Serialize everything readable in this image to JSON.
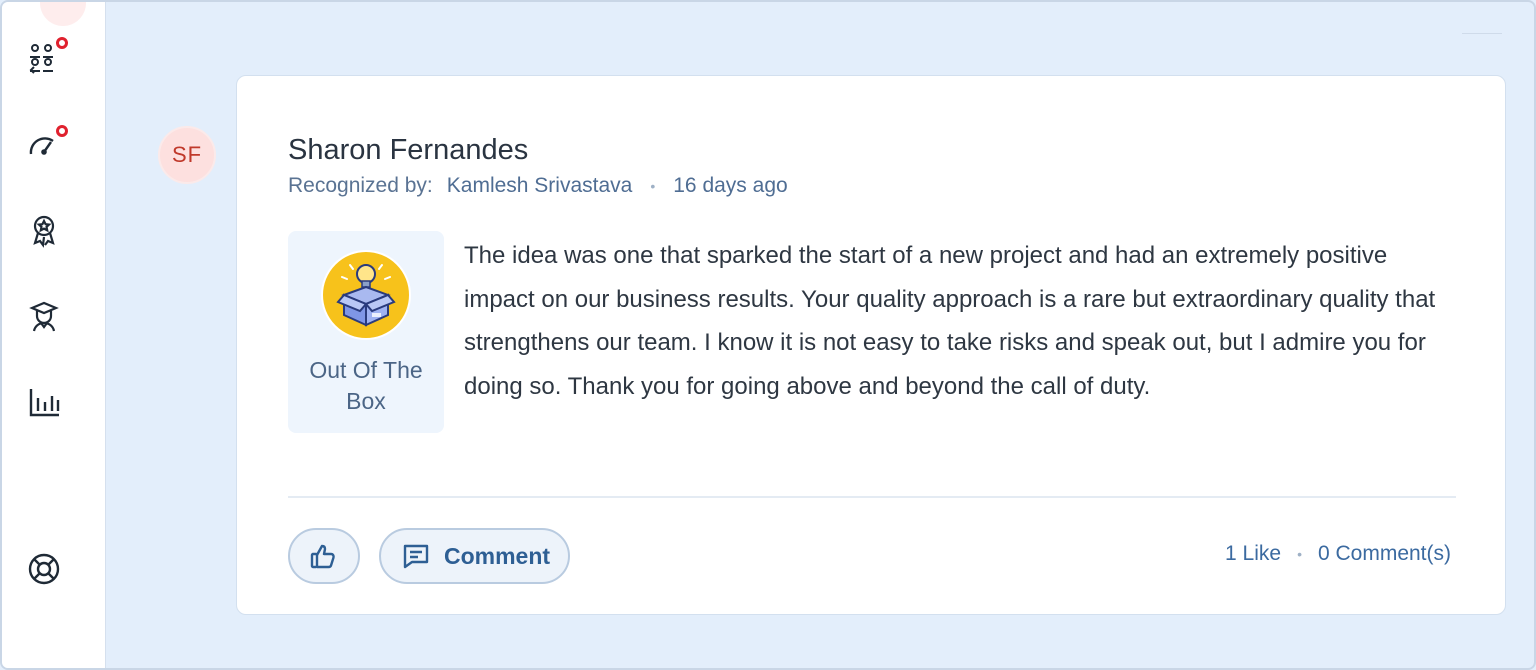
{
  "sidebar": {
    "items": [
      {
        "name": "team-icon",
        "has_badge": true
      },
      {
        "name": "speedometer-icon",
        "has_badge": true
      },
      {
        "name": "award-ribbon-icon",
        "has_badge": false
      },
      {
        "name": "graduate-icon",
        "has_badge": false
      },
      {
        "name": "bar-chart-icon",
        "has_badge": false
      },
      {
        "name": "lifebuoy-icon",
        "has_badge": false
      }
    ],
    "badge_color": "#e0212e"
  },
  "post": {
    "avatar_initials": "SF",
    "name": "Sharon Fernandes",
    "recognized_by_label": "Recognized by:",
    "recognized_by_name": "Kamlesh Srivastava",
    "separator": "•",
    "time_ago": "16 days ago",
    "award": {
      "icon": "idea-box-icon",
      "label": "Out Of The Box"
    },
    "message": "The idea was one that sparked the start of a new project and had an extremely positive impact on our business results. Your quality approach is a rare but extraordinary quality that strengthens our team. I know it is not easy to take risks and speak out, but I admire you for doing so. Thank you for going above and beyond the call of duty.",
    "actions": {
      "comment_label": "Comment"
    },
    "stats": {
      "likes": "1 Like",
      "separator": "•",
      "comments": "0 Comment(s)"
    }
  },
  "colors": {
    "accent": "#2e5f94",
    "background": "#e3eefb",
    "award_circle": "#f7c21b"
  }
}
